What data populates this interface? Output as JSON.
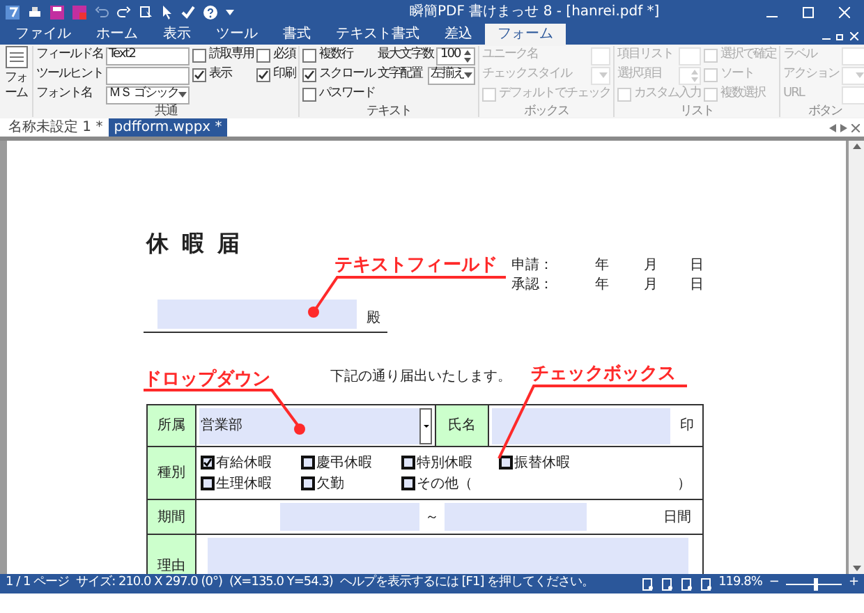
{
  "window": {
    "title": "瞬簡PDF 書けまっせ 8 - [hanrei.pdf *]"
  },
  "menu_tabs": [
    {
      "label": "ファイル",
      "selected": false
    },
    {
      "label": "ホーム",
      "selected": false
    },
    {
      "label": "表示",
      "selected": false
    },
    {
      "label": "ツール",
      "selected": false
    },
    {
      "label": "書式",
      "selected": false
    },
    {
      "label": "テキスト書式",
      "selected": false
    },
    {
      "label": "差込",
      "selected": false
    },
    {
      "label": "フォーム",
      "selected": true
    }
  ],
  "ribbon": {
    "form_button": "フォーム",
    "common": {
      "title": "共通",
      "fields": [
        {
          "label": "フィールド名",
          "value": "Text2",
          "kind": "text"
        },
        {
          "label": "ツールヒント",
          "kind": "text"
        },
        {
          "label": "フォント名",
          "value": "ＭＳ ゴシック",
          "kind": "dropdown"
        }
      ],
      "checks": [
        {
          "label": "読取専用",
          "checked": false
        },
        {
          "label": "必須",
          "checked": false
        },
        {
          "label": "表示",
          "checked": true
        },
        {
          "label": "印刷",
          "checked": true
        }
      ]
    },
    "text": {
      "title": "テキスト",
      "checks": [
        {
          "label": "複数行",
          "checked": false
        },
        {
          "label": "スクロール",
          "checked": true
        },
        {
          "label": "パスワード",
          "checked": false
        }
      ],
      "max_chars_label": "最大文字数",
      "max_chars": "100",
      "align_label": "文字配置",
      "align": "左揃え"
    },
    "box": {
      "title": "ボックス",
      "disabled": true,
      "fields": [
        {
          "label": "ユニーク名",
          "kind": "text"
        },
        {
          "label": "チェックスタイル",
          "kind": "dropdown"
        }
      ],
      "checks": [
        {
          "label": "デフォルトでチェック",
          "checked": false
        }
      ]
    },
    "list": {
      "title": "リスト",
      "disabled": true,
      "fields": [
        {
          "label": "項目リスト",
          "kind": "text"
        },
        {
          "label": "選択項目",
          "kind": "spin"
        }
      ],
      "checks": [
        {
          "label": "カスタム入力",
          "checked": false
        },
        {
          "label": "選択で確定",
          "checked": false
        },
        {
          "label": "ソート",
          "checked": false
        },
        {
          "label": "複数選択",
          "checked": false
        }
      ]
    },
    "button": {
      "title": "ボタン",
      "disabled": true,
      "fields": [
        {
          "label": "ラベル",
          "kind": "text"
        },
        {
          "label": "アクション",
          "kind": "dropdown"
        },
        {
          "label": "URL",
          "kind": "text"
        }
      ]
    }
  },
  "doc_tabs": [
    {
      "label": "名称未設定 1 *",
      "selected": false
    },
    {
      "label": "pdfform.wppx *",
      "selected": true
    }
  ],
  "form": {
    "title": "休 暇 届",
    "dates": [
      {
        "label": "申請：",
        "year": "年",
        "month": "月",
        "day": "日"
      },
      {
        "label": "承認：",
        "year": "年",
        "month": "月",
        "day": "日"
      }
    ],
    "addressee": "殿",
    "sentence": "下記の通り届出いたします。",
    "affiliation_label": "所属",
    "affiliation_value": "営業部",
    "name_label": "氏名",
    "seal": "印",
    "type_label": "種別",
    "types": [
      {
        "label": "有給休暇",
        "checked": true
      },
      {
        "label": "慶弔休暇",
        "checked": false
      },
      {
        "label": "特別休暇",
        "checked": false
      },
      {
        "label": "振替休暇",
        "checked": false
      },
      {
        "label": "生理休暇",
        "checked": false
      },
      {
        "label": "欠勤",
        "checked": false
      },
      {
        "label": "その他（",
        "checked": false
      }
    ],
    "other_close": "）",
    "period_label": "期間",
    "period_sep": "～",
    "days": "日間",
    "reason_label": "理由"
  },
  "annotations": [
    {
      "label": "テキストフィールド"
    },
    {
      "label": "ドロップダウン"
    },
    {
      "label": "チェックボックス"
    }
  ],
  "status_bar": {
    "page": "1 / 1 ページ",
    "size": "サイズ: 210.0 X 297.0 (0°)",
    "position": "(X=135.0 Y=54.3)",
    "help": "ヘルプを表示するには [F1] を押してください。",
    "zoom": "119.8%",
    "zoom_minus": "−",
    "zoom_plus": "+",
    "level": 0.5
  }
}
